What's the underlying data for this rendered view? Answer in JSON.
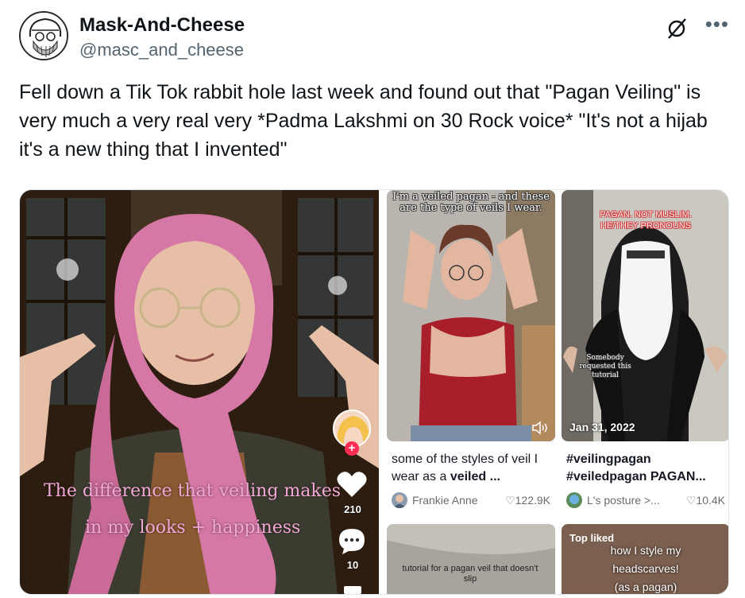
{
  "tweet": {
    "display_name": "Mask-And-Cheese",
    "handle": "@masc_and_cheese",
    "text": "Fell down a Tik Tok rabbit hole last week and found out that \"Pagan Veiling\" is very much a very real very *Padma Lakshmi on 30 Rock voice* \"It's not a hijab it's a new thing that I invented\"",
    "more_icon": "more-icon",
    "grok_icon": "grok-icon"
  },
  "main_video": {
    "overlay_line1": "The difference that veiling makes",
    "overlay_line2": "in my looks + happiness",
    "like_count": "210",
    "comment_count": "10",
    "follow_icon": "+"
  },
  "cards": [
    {
      "thumb_text": "I'm a veiled pagan - and these are the type of veils I wear.",
      "caption_plain": "some of the styles of veil I wear as a ",
      "caption_bold": "veiled ...",
      "author": "Frankie Anne",
      "likes": "122.9K"
    },
    {
      "thumb_text_line1": "PAGAN. NOT MUSLIM.",
      "thumb_text_line2": "HE/THEY PRONOUNS",
      "thumb_small": "Somebody requested this tutorial",
      "date": "Jan 31, 2022",
      "caption_line1": "#veilingpagan",
      "caption_line2": "#veiledpagan PAGAN...",
      "author": "L's posture >...",
      "likes": "10.4K"
    },
    {
      "thumb_text": "tutorial for a pagan veil that doesn't slip"
    },
    {
      "badge": "Top liked",
      "thumb_text_line1": "how I style my",
      "thumb_text_line2": "headscarves!",
      "thumb_text_line3": "(as a pagan)"
    }
  ],
  "colors": {
    "text_primary": "#0f1419",
    "text_secondary": "#536471",
    "overlay_pink": "#f2a8d5",
    "tiktok_red": "#ff2c55"
  }
}
